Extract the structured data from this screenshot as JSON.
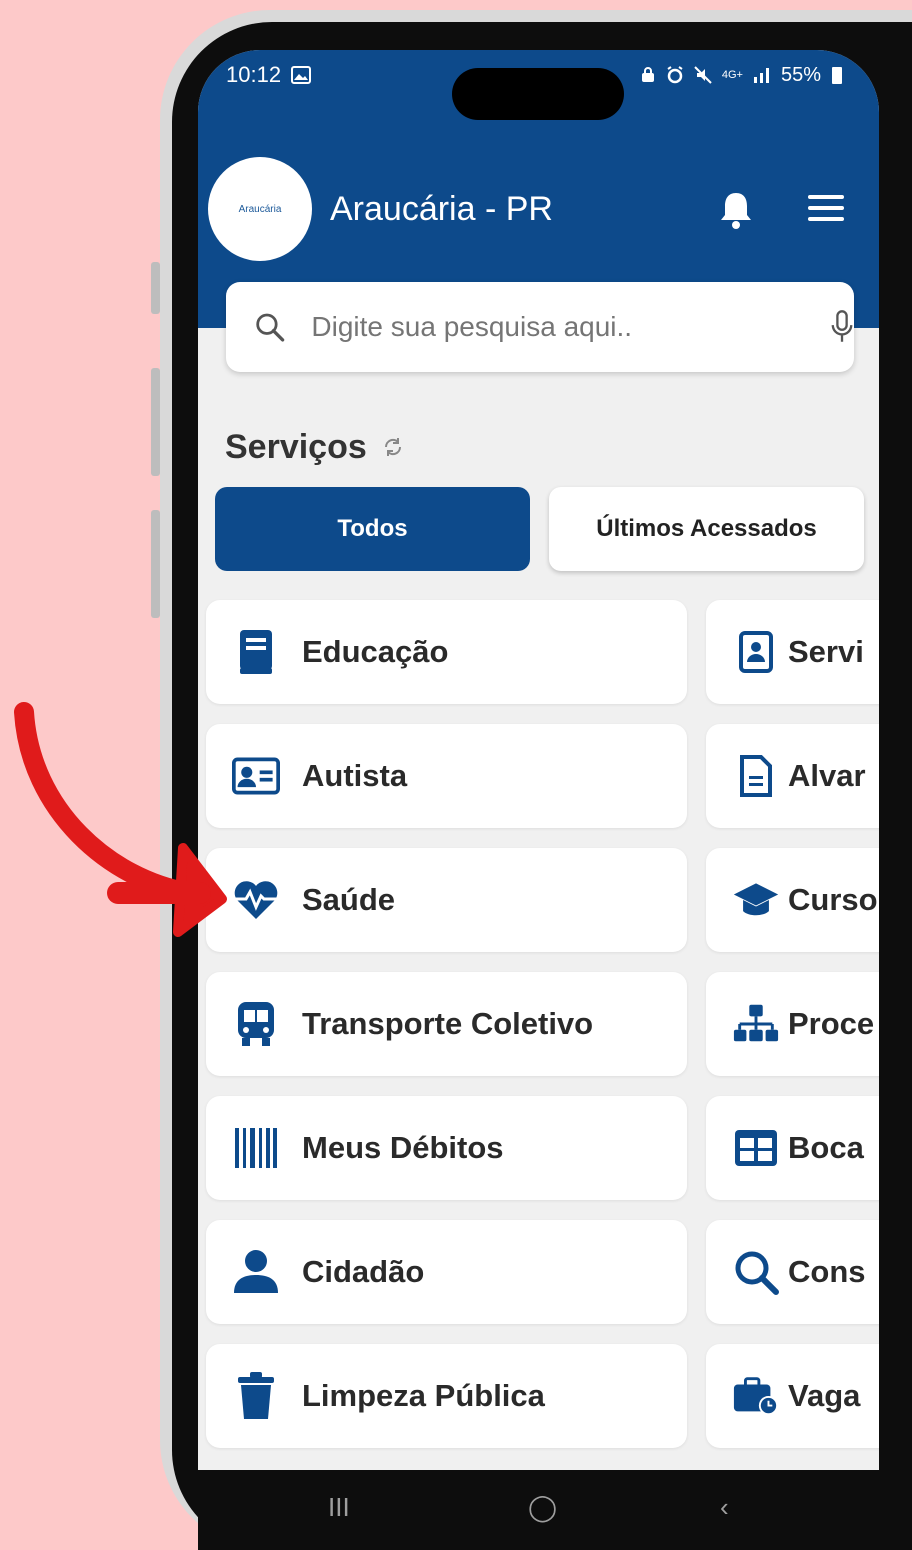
{
  "status_bar": {
    "time": "10:12",
    "battery": "55%",
    "network": "4G+"
  },
  "header": {
    "logo_text": "Araucária",
    "city": "Araucária - PR"
  },
  "search": {
    "placeholder": "Digite sua pesquisa aqui.."
  },
  "services": {
    "title": "Serviços",
    "tabs": [
      {
        "label": "Todos",
        "active": true
      },
      {
        "label": "Últimos Acessados",
        "active": false
      }
    ],
    "left": [
      {
        "label": "Educação",
        "icon": "book-icon"
      },
      {
        "label": "Autista",
        "icon": "id-card-icon"
      },
      {
        "label": "Saúde",
        "icon": "heartbeat-icon"
      },
      {
        "label": "Transporte Coletivo",
        "icon": "bus-icon"
      },
      {
        "label": "Meus Débitos",
        "icon": "barcode-icon"
      },
      {
        "label": "Cidadão",
        "icon": "user-icon"
      },
      {
        "label": "Limpeza Pública",
        "icon": "trash-icon"
      }
    ],
    "right": [
      {
        "label": "Servi",
        "icon": "badge-icon"
      },
      {
        "label": "Alvar",
        "icon": "file-icon"
      },
      {
        "label": "Curso",
        "icon": "graduation-cap-icon"
      },
      {
        "label": "Proce",
        "icon": "sitemap-icon"
      },
      {
        "label": "Boca",
        "icon": "table-icon"
      },
      {
        "label": "Cons",
        "icon": "search-icon"
      },
      {
        "label": "Vaga",
        "icon": "briefcase-clock-icon"
      }
    ]
  },
  "nav": {
    "recent": "III",
    "home": "◯",
    "back": "‹"
  },
  "colors": {
    "brand": "#0d4a8b",
    "background": "#fdc9c9",
    "arrow": "#e01b1b"
  }
}
